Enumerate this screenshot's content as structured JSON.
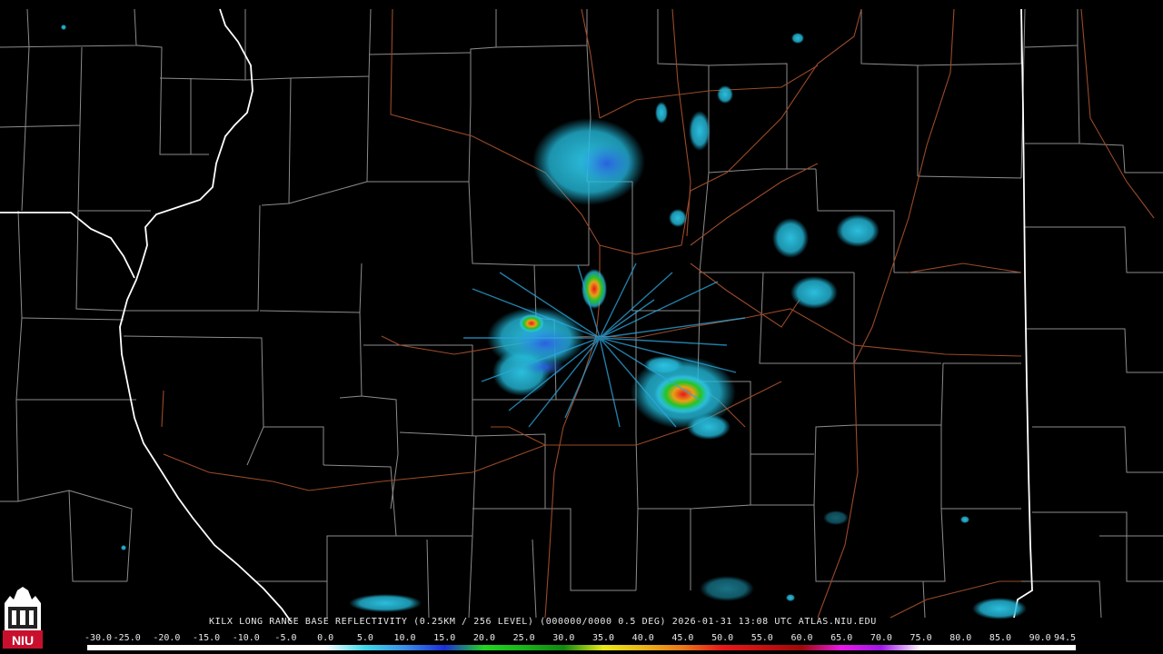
{
  "product": {
    "caption": "KILX LONG RANGE BASE REFLECTIVITY (0.25KM / 256 LEVEL) (000000/0000 0.5 DEG) 2026-01-31 13:08 UTC  ATLAS.NIU.EDU",
    "radar_site": "KILX",
    "timestamp": "2026-01-31 13:08 UTC",
    "source": "ATLAS.NIU.EDU"
  },
  "logo": {
    "text": "NIU",
    "icon": "niu-building-logo"
  },
  "colorbar": {
    "ticks": [
      "-30.0",
      "-25.0",
      "-20.0",
      "-15.0",
      "-10.0",
      "-5.0",
      "0.0",
      "5.0",
      "10.0",
      "15.0",
      "20.0",
      "25.0",
      "30.0",
      "35.0",
      "40.0",
      "45.0",
      "50.0",
      "55.0",
      "60.0",
      "65.0",
      "70.0",
      "75.0",
      "80.0",
      "85.0",
      "90.0",
      "94.5"
    ],
    "stops": [
      {
        "dbz": -30,
        "color": "#ffffff"
      },
      {
        "dbz": 0,
        "color": "#ffffff"
      },
      {
        "dbz": 5,
        "color": "#3fd7e8"
      },
      {
        "dbz": 10,
        "color": "#3a8fe8"
      },
      {
        "dbz": 15,
        "color": "#1c2fd8"
      },
      {
        "dbz": 20,
        "color": "#22d422"
      },
      {
        "dbz": 25,
        "color": "#18b418"
      },
      {
        "dbz": 30,
        "color": "#0f8a0f"
      },
      {
        "dbz": 35,
        "color": "#e8e818"
      },
      {
        "dbz": 40,
        "color": "#e8b418"
      },
      {
        "dbz": 45,
        "color": "#e87818"
      },
      {
        "dbz": 50,
        "color": "#e81818"
      },
      {
        "dbz": 55,
        "color": "#c81010"
      },
      {
        "dbz": 60,
        "color": "#a00808"
      },
      {
        "dbz": 65,
        "color": "#e818e8"
      },
      {
        "dbz": 70,
        "color": "#a018e8"
      },
      {
        "dbz": 75,
        "color": "#ffffff"
      },
      {
        "dbz": 94.5,
        "color": "#ffffff"
      }
    ]
  },
  "colors": {
    "background": "#000000",
    "county_lines": "#8c8c8c",
    "state_lines": "#ffffff",
    "highways": "#9a4a28"
  }
}
